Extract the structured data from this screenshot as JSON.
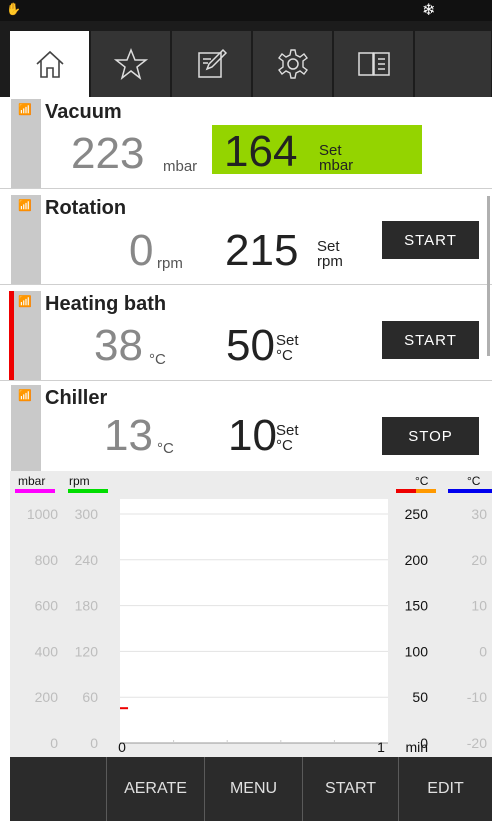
{
  "tabs": [
    {
      "name": "home-icon",
      "active": true
    },
    {
      "name": "star-icon",
      "active": false
    },
    {
      "name": "edit-icon",
      "active": false
    },
    {
      "name": "gear-icon",
      "active": false
    },
    {
      "name": "manual-icon",
      "active": false
    }
  ],
  "vacuum": {
    "label": "Vacuum",
    "value": "223",
    "unit": "mbar",
    "set_value": "164",
    "set_label": "Set",
    "set_unit": "mbar"
  },
  "rotation": {
    "label": "Rotation",
    "value": "0",
    "unit": "rpm",
    "set_value": "215",
    "set_label": "Set",
    "set_unit": "rpm",
    "button": "START"
  },
  "heating": {
    "label": "Heating bath",
    "value": "38",
    "unit": "°C",
    "set_value": "50",
    "set_label": "Set",
    "set_unit": "°C",
    "button": "START"
  },
  "chiller": {
    "label": "Chiller",
    "value": "13",
    "unit": "°C",
    "set_value": "10",
    "set_label": "Set",
    "set_unit": "°C",
    "button": "STOP"
  },
  "chart": {
    "left_units": [
      "mbar",
      "rpm"
    ],
    "right_units": [
      "°C",
      "°C"
    ],
    "mbar_ticks": [
      "1000",
      "800",
      "600",
      "400",
      "200",
      "0"
    ],
    "rpm_ticks": [
      "300",
      "240",
      "180",
      "120",
      "60",
      "0"
    ],
    "bath_ticks": [
      "250",
      "200",
      "150",
      "100",
      "50",
      "0"
    ],
    "chiller_ticks": [
      "30",
      "20",
      "10",
      "0",
      "-10",
      "-20"
    ],
    "x_ticks": [
      "0",
      "1"
    ],
    "x_unit": "min",
    "colors": {
      "mbar": "#ff00ff",
      "rpm": "#00dd00",
      "bath_a": "#ee0000",
      "bath_b": "#ff9900",
      "chiller": "#0000ee"
    }
  },
  "chart_data": {
    "type": "line",
    "x_range": [
      0,
      1
    ],
    "xlabel": "min",
    "axes": [
      {
        "unit": "mbar",
        "range": [
          0,
          1000
        ]
      },
      {
        "unit": "rpm",
        "range": [
          0,
          300
        ]
      },
      {
        "unit": "°C",
        "range": [
          0,
          250
        ]
      },
      {
        "unit": "°C",
        "range": [
          -20,
          30
        ]
      }
    ],
    "series": [
      {
        "color": "#ee0000",
        "points": [
          [
            0,
            38
          ],
          [
            0.03,
            38
          ]
        ]
      }
    ]
  },
  "bottom": {
    "aerate": "AERATE",
    "menu": "MENU",
    "start": "START",
    "edit": "EDIT"
  }
}
